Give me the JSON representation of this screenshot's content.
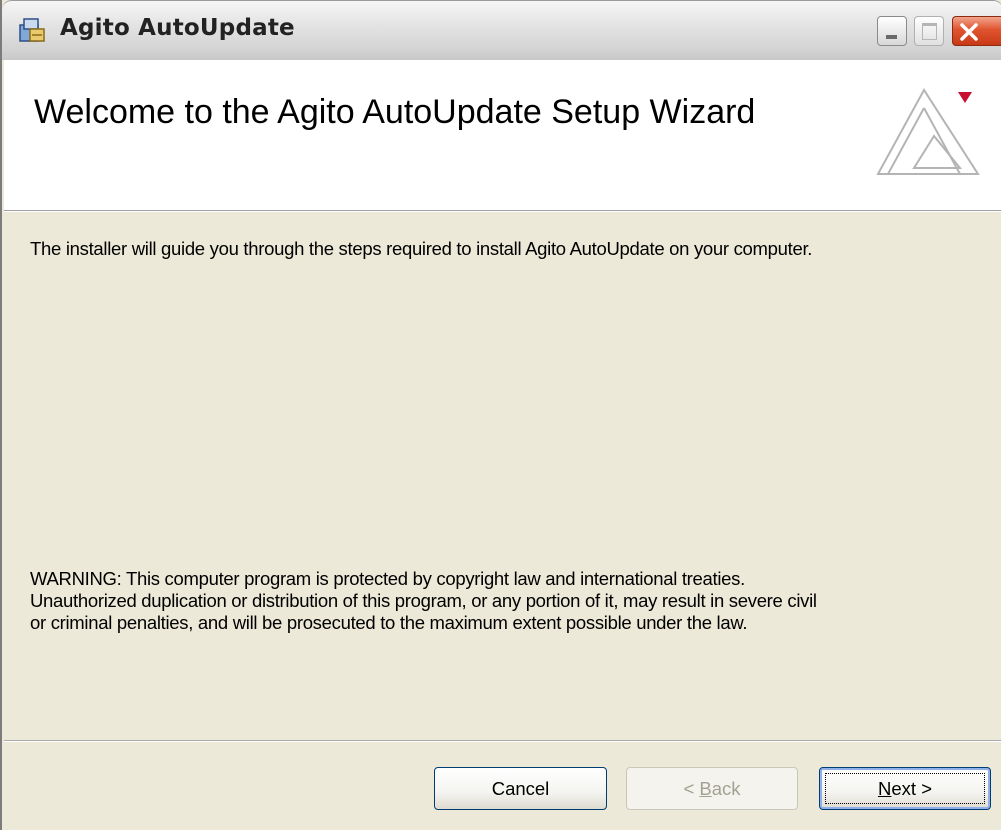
{
  "window": {
    "title": "Agito AutoUpdate",
    "icons": {
      "app": "installer-icon",
      "minimize": "minimize-icon",
      "maximize": "maximize-icon",
      "close": "close-icon"
    }
  },
  "header": {
    "title": "Welcome to the Agito AutoUpdate Setup Wizard",
    "logo": "agito-logo-icon"
  },
  "body": {
    "intro": "The installer will guide you through the steps required to install Agito AutoUpdate on your computer.",
    "warning_lines": [
      "WARNING: This computer program is protected by copyright law and international treaties.",
      "Unauthorized duplication or distribution of this program, or any portion of it, may result in severe civil",
      "or criminal penalties, and will be prosecuted to the maximum extent possible under the law."
    ]
  },
  "buttons": {
    "cancel": "Cancel",
    "back_prefix": "< ",
    "back_mnemonic": "B",
    "back_rest": "ack",
    "next_mnemonic": "N",
    "next_rest": "ext >",
    "back_enabled": false
  },
  "colors": {
    "accent_red": "#c8102e",
    "dialog_bg": "#ece9d8",
    "close_red": "#e0542f"
  }
}
